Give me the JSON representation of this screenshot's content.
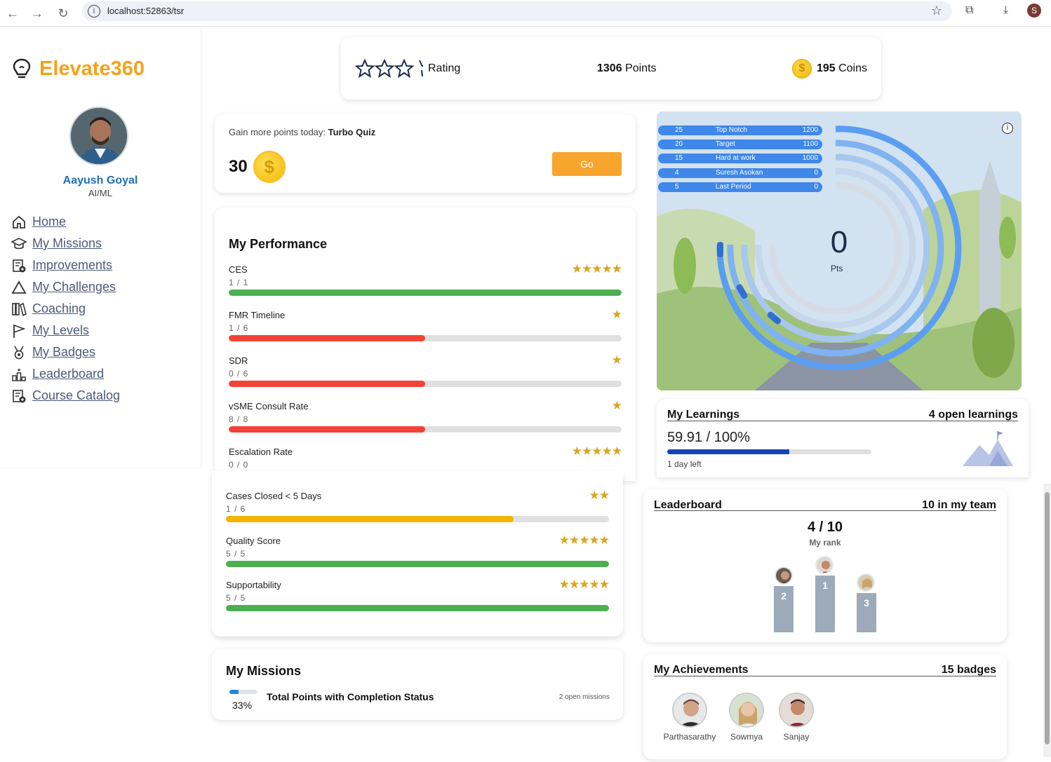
{
  "browser": {
    "url": "localhost:52863/tsr",
    "profile_initial": "S"
  },
  "app": {
    "name": "Elevate360",
    "accent": "#f5a11c"
  },
  "profile": {
    "name": "Aayush Goyal",
    "role": "AI/ML"
  },
  "sidebar": {
    "items": [
      {
        "label": "Home",
        "icon": "home-icon"
      },
      {
        "label": "My Missions",
        "icon": "graduation-cap-icon"
      },
      {
        "label": "Improvements",
        "icon": "catalog-icon"
      },
      {
        "label": "My Challenges",
        "icon": "mountain-icon"
      },
      {
        "label": "Coaching",
        "icon": "books-icon"
      },
      {
        "label": "My Levels",
        "icon": "flag-icon"
      },
      {
        "label": "My Badges",
        "icon": "medal-icon"
      },
      {
        "label": "Leaderboard",
        "icon": "podium-icon"
      },
      {
        "label": "Course Catalog",
        "icon": "catalog-icon"
      }
    ]
  },
  "stats": {
    "rating_label": "Rating",
    "rating_stars": 0,
    "points_value": "1306",
    "points_label": "Points",
    "coins_value": "195",
    "coins_label": "Coins"
  },
  "gain": {
    "prefix": "Gain more points today: ",
    "quiz": "Turbo Quiz",
    "amount": "30",
    "button": "Go"
  },
  "performance": {
    "title": "My Performance",
    "metrics": [
      {
        "name": "CES",
        "value": "1 / 1",
        "stars": "★★★★★",
        "progress": 1.0,
        "color": "#4caf50"
      },
      {
        "name": "FMR Timeline",
        "value": "1 / 6",
        "stars": "★",
        "progress": 0.5,
        "color": "#f44336"
      },
      {
        "name": "SDR",
        "value": "0 / 6",
        "stars": "★",
        "progress": 0.5,
        "color": "#f44336"
      },
      {
        "name": "vSME Consult Rate",
        "value": "8 / 8",
        "stars": "★",
        "progress": 0.5,
        "color": "#f44336"
      },
      {
        "name": "Escalation Rate",
        "value": "0 / 0",
        "stars": "★★★★★",
        "progress": 1.0,
        "color": "#4caf50"
      },
      {
        "name": "Cases Closed < 5 Days",
        "value": "1 / 6",
        "stars": "★★",
        "progress": 0.75,
        "color": "#f5b400"
      },
      {
        "name": "Quality Score",
        "value": "5 / 5",
        "stars": "★★★★★",
        "progress": 1.0,
        "color": "#4caf50"
      },
      {
        "name": "Supportability",
        "value": "5 / 5",
        "stars": "★★★★★",
        "progress": 1.0,
        "color": "#4caf50"
      }
    ]
  },
  "race": {
    "rows": [
      {
        "rank": "25",
        "name": "Top Notch",
        "points": "1200"
      },
      {
        "rank": "20",
        "name": "Target",
        "points": "1100"
      },
      {
        "rank": "15",
        "name": "Hard at work",
        "points": "1000"
      },
      {
        "rank": "4",
        "name": "Suresh Asokan",
        "points": "0"
      },
      {
        "rank": "5",
        "name": "Last Period",
        "points": "0"
      }
    ],
    "score": "0",
    "score_label": "Pts"
  },
  "learnings": {
    "title": "My Learnings",
    "open": "4 open learnings",
    "progress_text": "59.91 / 100%",
    "progress": 0.5991,
    "time_left": "1 day left"
  },
  "leaderboard": {
    "title": "Leaderboard",
    "team": "10 in my team",
    "rank": "4 / 10",
    "rank_label": "My rank",
    "podium": [
      "2",
      "1",
      "3"
    ]
  },
  "achievements": {
    "title": "My Achievements",
    "badges": "15 badges",
    "people": [
      "Parthasarathy",
      "Sowmya",
      "Sanjay"
    ]
  },
  "missions": {
    "title": "My Missions",
    "percent": "33%",
    "progress": 0.33,
    "mission_name": "Total Points with Completion Status",
    "open": "2 open missions"
  }
}
